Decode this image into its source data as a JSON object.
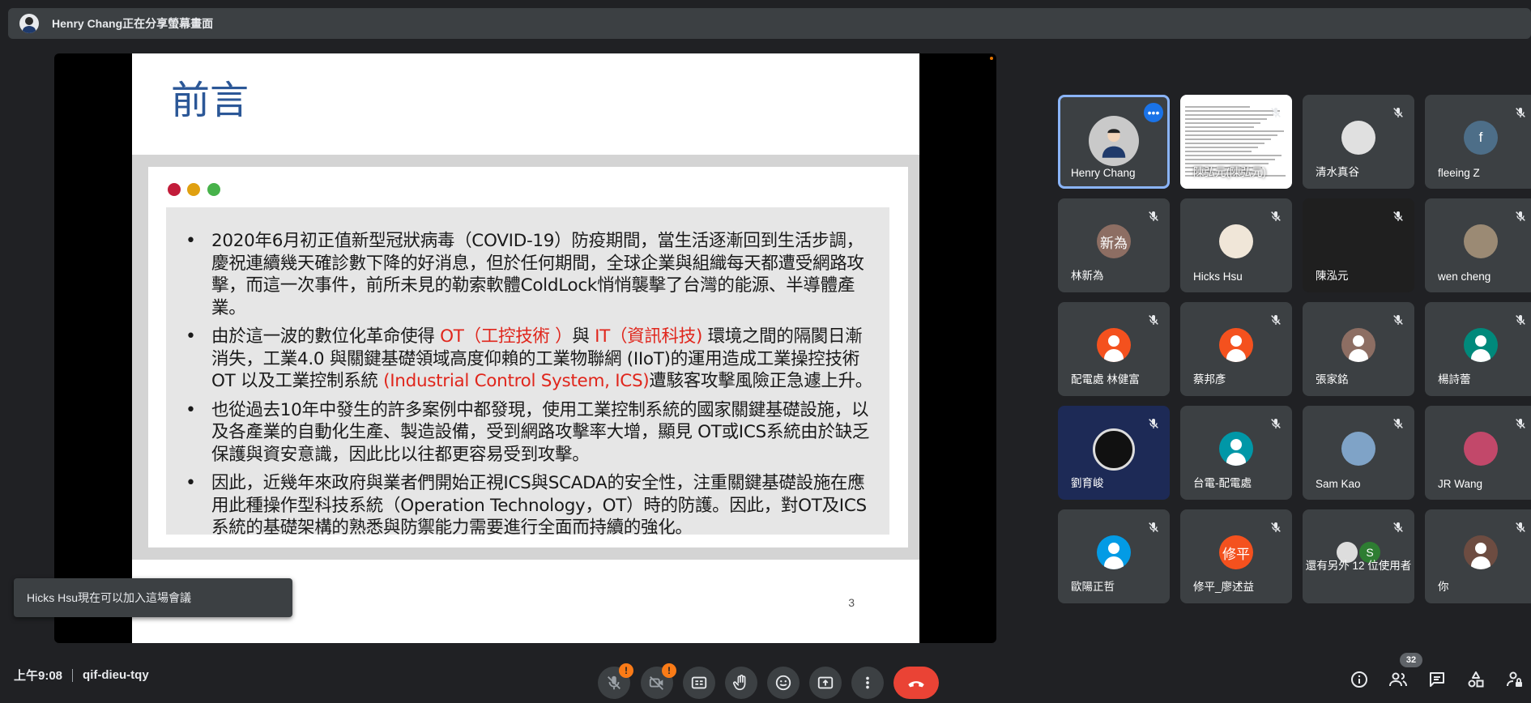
{
  "banner": {
    "presenter_text": "Henry Chang正在分享螢幕畫面"
  },
  "slide": {
    "title": "前言",
    "bullets": [
      {
        "parts": [
          {
            "t": "2020年6月初正值新型冠狀病毒（COVID-19）防疫期間，當生活逐漸回到生活步調，慶祝連續幾天確診數下降的好消息，但於任何期間，全球企業與組織每天都遭受網路攻擊，而這一次事件，前所未見的勒索軟體ColdLock悄悄襲擊了台灣的能源、半導體產業。",
            "red": false
          }
        ]
      },
      {
        "parts": [
          {
            "t": "由於這一波的數位化革命使得 ",
            "red": false
          },
          {
            "t": "OT（工控技術 ）",
            "red": true
          },
          {
            "t": "與 ",
            "red": false
          },
          {
            "t": "IT（資訊科技)",
            "red": true
          },
          {
            "t": " 環境之間的隔閡日漸消失，工業4.0 與關鍵基礎領域高度仰賴的工業物聯網 (IIoT)的運用造成工業操控技術 OT 以及工業控制系統 ",
            "red": false
          },
          {
            "t": "(Industrial Control System, ICS)",
            "red": true
          },
          {
            "t": "遭駭客攻擊風險正急遽上升。",
            "red": false
          }
        ]
      },
      {
        "parts": [
          {
            "t": "也從過去10年中發生的許多案例中都發現，使用工業控制系統的國家關鍵基礎設施，以及各產業的自動化生產、製造設備，受到網路攻擊率大增，顯見 OT或ICS系統由於缺乏保護與資安意識，因此比以往都更容易受到攻擊。",
            "red": false
          }
        ]
      },
      {
        "parts": [
          {
            "t": "因此，近幾年來政府與業者們開始正視ICS與SCADA的安全性，注重關鍵基礎設施在應用此種操作型科技系統（Operation Technology，OT）時的防護。因此，對OT及ICS系統的基礎架構的熟悉與防禦能力需要進行全面而持續的強化。",
            "red": false
          }
        ]
      }
    ],
    "page_number": "3"
  },
  "toast": {
    "text": "Hicks Hsu現在可以加入這場會議"
  },
  "participants": [
    {
      "name": "Henry Chang",
      "avatar": "photo-man",
      "active": true
    },
    {
      "name": "陳弘元(陳弘元)",
      "avatar": "screenshot"
    },
    {
      "name": "清水真谷",
      "avatar": "photo-anime"
    },
    {
      "name": "fleeing Z",
      "avatar": "letter",
      "letter": "f",
      "color": "#4d6e88"
    },
    {
      "name": "林新為",
      "avatar": "letter",
      "letter": "新為",
      "color": "#8d6e63"
    },
    {
      "name": "Hicks Hsu",
      "avatar": "photo-comic"
    },
    {
      "name": "陳泓元",
      "avatar": "none"
    },
    {
      "name": "wen cheng",
      "avatar": "photo-texture"
    },
    {
      "name": "配電處 林健富",
      "avatar": "person",
      "color": "#f4511e"
    },
    {
      "name": "蔡邦彥",
      "avatar": "person",
      "color": "#f4511e"
    },
    {
      "name": "張家銘",
      "avatar": "person",
      "color": "#8d6e63"
    },
    {
      "name": "楊詩蕾",
      "avatar": "person",
      "color": "#00897b"
    },
    {
      "name": "劉育峻",
      "avatar": "obs"
    },
    {
      "name": "台電-配電處",
      "avatar": "person",
      "color": "#0097a7"
    },
    {
      "name": "Sam Kao",
      "avatar": "photo-sky"
    },
    {
      "name": "JR Wang",
      "avatar": "photo-flowers"
    },
    {
      "name": "歐陽正哲",
      "avatar": "person",
      "color": "#039be5"
    },
    {
      "name": "修平_廖述益",
      "avatar": "letter",
      "letter": "修平",
      "color": "#f4511e"
    },
    {
      "name": "還有另外 12 位使用者",
      "avatar": "group"
    },
    {
      "name": "你",
      "avatar": "person",
      "color": "#6d4c41"
    }
  ],
  "bottom": {
    "time": "上午9:08",
    "meeting_code": "qif-dieu-tqy",
    "mic_badge": "!",
    "cam_badge": "!",
    "people_count": "32"
  },
  "colors": {
    "bg": "#202124",
    "tile": "#3c4043",
    "accent": "#1a73e8",
    "hangup": "#ea4335",
    "warn": "#fa7b17"
  }
}
